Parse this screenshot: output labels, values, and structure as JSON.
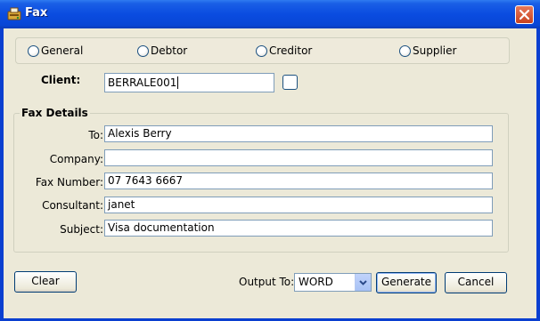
{
  "window": {
    "title": "Fax"
  },
  "record_type": {
    "options": [
      "General",
      "Debtor",
      "Creditor",
      "Supplier"
    ],
    "selected": null
  },
  "client": {
    "label": "Client:",
    "value": "BERRALE001"
  },
  "fax_details": {
    "title": "Fax Details",
    "fields": [
      {
        "label": "To:",
        "value": "Alexis Berry"
      },
      {
        "label": "Company:",
        "value": ""
      },
      {
        "label": "Fax Number:",
        "value": "07 7643 6667"
      },
      {
        "label": "Consultant:",
        "value": "janet"
      },
      {
        "label": "Subject:",
        "value": "Visa documentation"
      }
    ]
  },
  "footer": {
    "clear_label": "Clear",
    "output_label": "Output To:",
    "output_value": "WORD",
    "generate_label": "Generate",
    "cancel_label": "Cancel"
  }
}
